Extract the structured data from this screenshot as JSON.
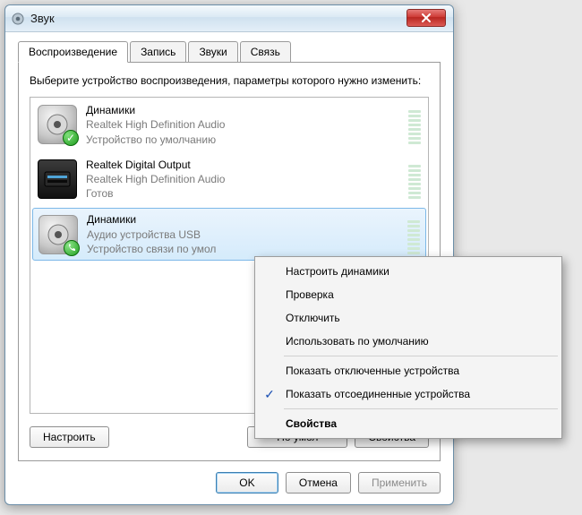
{
  "window": {
    "title": "Звук"
  },
  "tabs": {
    "playback": "Воспроизведение",
    "record": "Запись",
    "sounds": "Звуки",
    "comm": "Связь"
  },
  "instruction": "Выберите устройство воспроизведения, параметры которого нужно изменить:",
  "devices": [
    {
      "name": "Динамики",
      "driver": "Realtek High Definition Audio",
      "status": "Устройство по умолчанию"
    },
    {
      "name": "Realtek Digital Output",
      "driver": "Realtek High Definition Audio",
      "status": "Готов"
    },
    {
      "name": "Динамики",
      "driver": "Аудио устройства USB",
      "status": "Устройство связи по умол"
    }
  ],
  "panel_buttons": {
    "configure": "Настроить",
    "default": "По умол",
    "properties": "Свойства"
  },
  "dialog_buttons": {
    "ok": "OK",
    "cancel": "Отмена",
    "apply": "Применить"
  },
  "context_menu": {
    "configure_speakers": "Настроить динамики",
    "test": "Проверка",
    "disable": "Отключить",
    "set_default": "Использовать по умолчанию",
    "show_disabled": "Показать отключенные устройства",
    "show_disconnected": "Показать отсоединенные устройства",
    "properties": "Свойства"
  }
}
